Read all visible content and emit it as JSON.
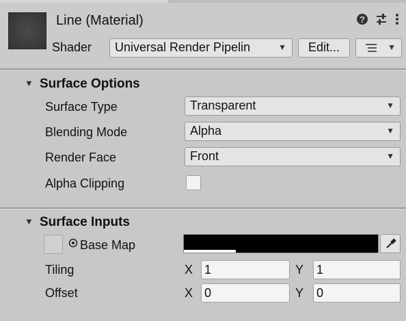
{
  "header": {
    "title": "Line (Material)",
    "icons": {
      "help": "help-icon",
      "presets": "presets-sliders-icon",
      "more": "kebab-menu-icon"
    },
    "shader_label": "Shader",
    "shader_value": "Universal Render Pipelin",
    "edit_label": "Edit...",
    "list_menu_icon": "list-icon"
  },
  "surface_options": {
    "title": "Surface Options",
    "properties": [
      {
        "label": "Surface Type",
        "value": "Transparent"
      },
      {
        "label": "Blending Mode",
        "value": "Alpha"
      },
      {
        "label": "Render Face",
        "value": "Front"
      },
      {
        "label": "Alpha Clipping",
        "checked": false
      }
    ]
  },
  "surface_inputs": {
    "title": "Surface Inputs",
    "base_map_label": "Base Map",
    "base_map_color": "#000000",
    "tiling": {
      "label": "Tiling",
      "x_label": "X",
      "x": "1",
      "y_label": "Y",
      "y": "1"
    },
    "offset": {
      "label": "Offset",
      "x_label": "X",
      "x": "0",
      "y_label": "Y",
      "y": "0"
    }
  },
  "colors": {
    "panel_bg": "#c8c8c8",
    "field_bg": "#f4f4f4",
    "dropdown_bg": "#e4e4e4"
  }
}
